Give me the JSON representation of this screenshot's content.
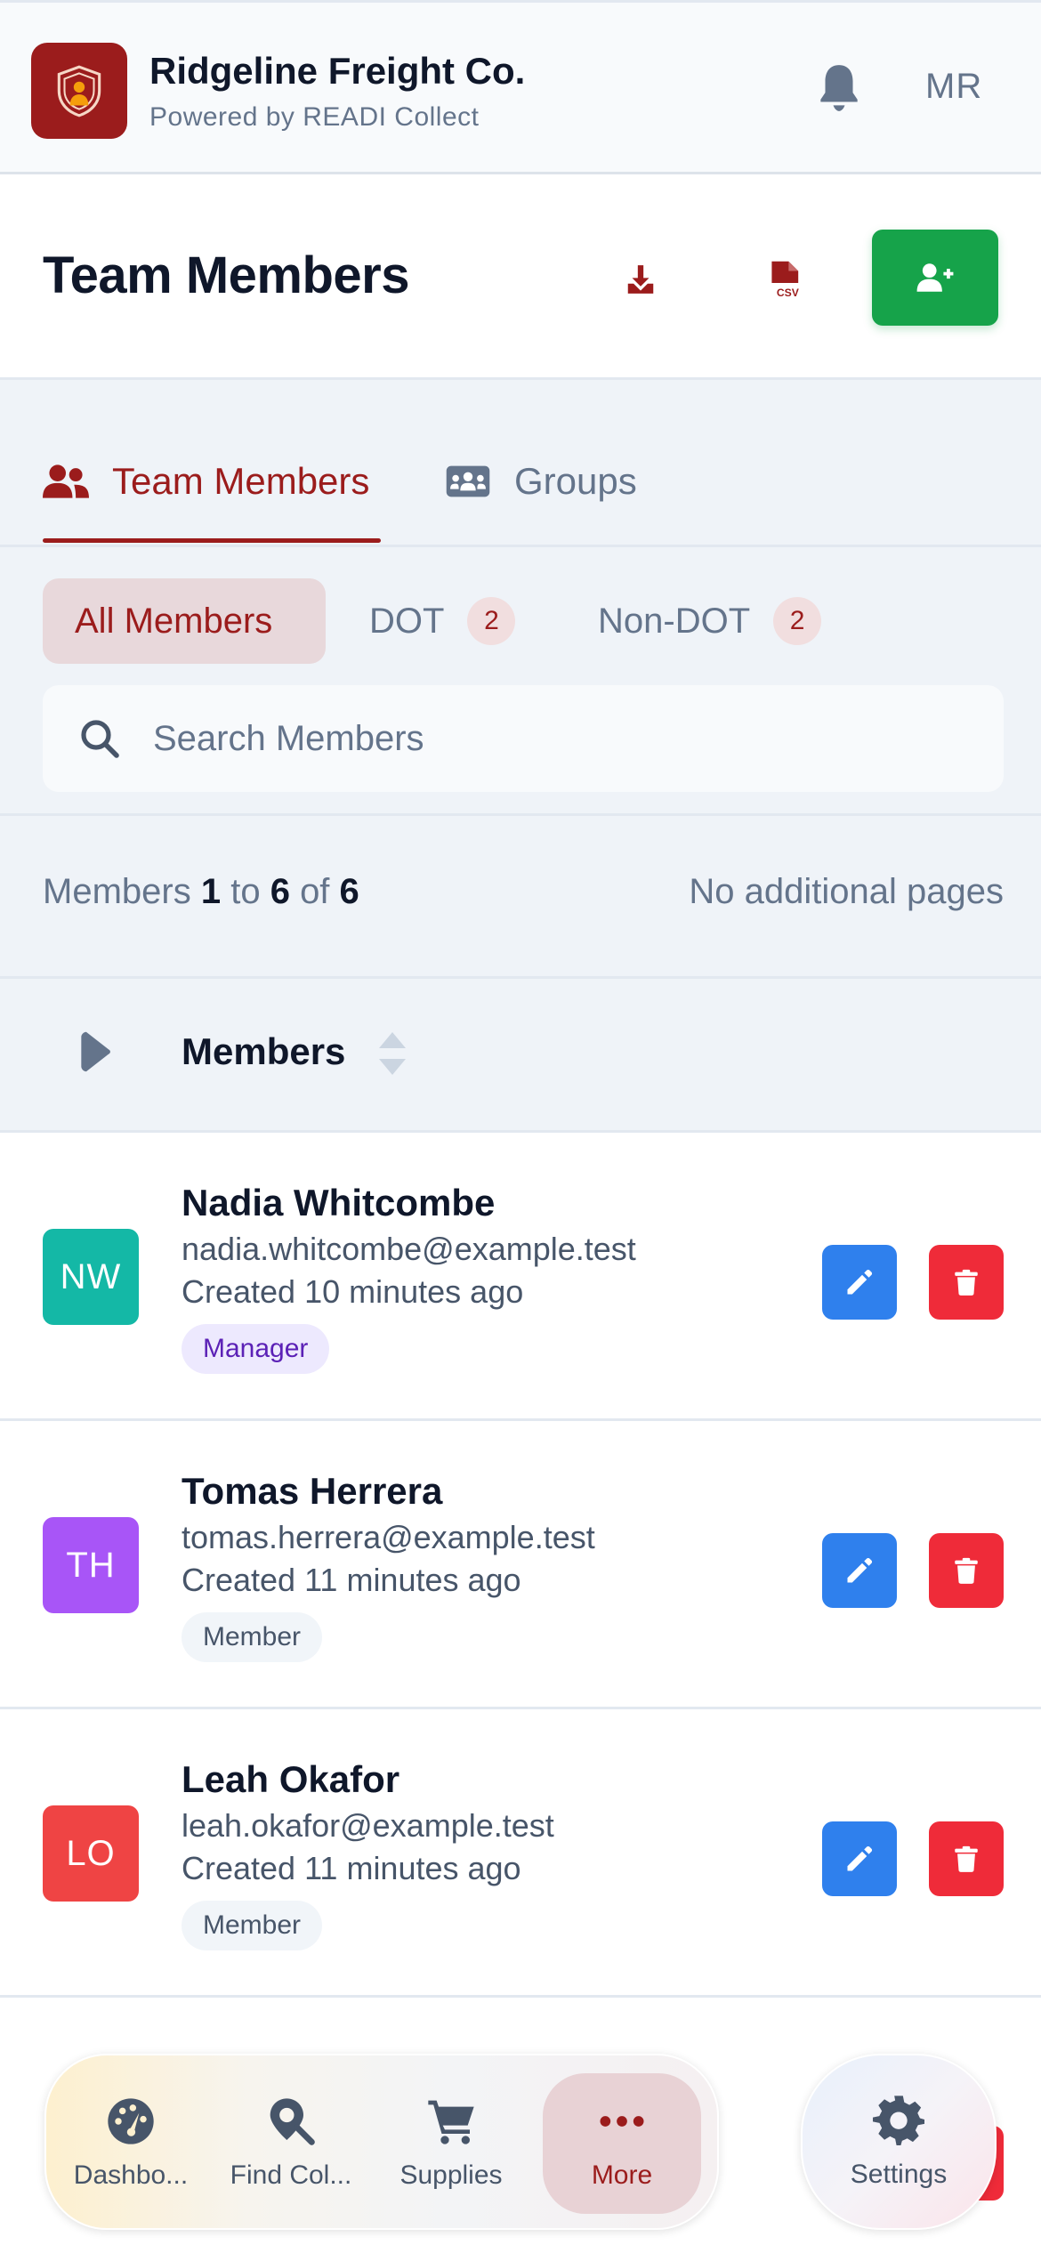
{
  "app": {
    "company": "Ridgeline Freight Co.",
    "powered_by": "Powered by READI Collect",
    "user_initials": "MR"
  },
  "page": {
    "title": "Team Members"
  },
  "tabs": [
    {
      "label": "Team Members",
      "active": true
    },
    {
      "label": "Groups",
      "active": false
    }
  ],
  "filters": [
    {
      "label": "All Members",
      "count": "",
      "active": true
    },
    {
      "label": "DOT",
      "count": "2",
      "active": false
    },
    {
      "label": "Non-DOT",
      "count": "2",
      "active": false
    }
  ],
  "search": {
    "placeholder": "Search Members",
    "value": ""
  },
  "pagination": {
    "prefix": "Members",
    "from": "1",
    "to_word": "to",
    "to": "6",
    "of_word": "of",
    "total": "6",
    "note": "No additional pages"
  },
  "list_header": {
    "title": "Members"
  },
  "members": [
    {
      "initials": "NW",
      "color": "#14b8a6",
      "name": "Nadia Whitcombe",
      "email": "nadia.whitcombe@example.test",
      "created": "Created 10 minutes ago",
      "role": "Manager"
    },
    {
      "initials": "TH",
      "color": "#a855f7",
      "name": "Tomas Herrera",
      "email": "tomas.herrera@example.test",
      "created": "Created 11 minutes ago",
      "role": "Member"
    },
    {
      "initials": "LO",
      "color": "#ef4444",
      "name": "Leah Okafor",
      "email": "leah.okafor@example.test",
      "created": "Created 11 minutes ago",
      "role": "Member"
    }
  ],
  "dock": [
    {
      "label": "Dashbo...",
      "icon": "dashboard-gauge-icon"
    },
    {
      "label": "Find Col...",
      "icon": "map-search-icon"
    },
    {
      "label": "Supplies",
      "icon": "cart-icon"
    },
    {
      "label": "More",
      "icon": "more-dots-icon",
      "selected": true
    }
  ],
  "settings": {
    "label": "Settings",
    "icon": "gear-icon"
  },
  "colors": {
    "brand": "#9b1c1c",
    "add": "#16a34a",
    "edit": "#2f80ed",
    "delete": "#ef2b39"
  }
}
